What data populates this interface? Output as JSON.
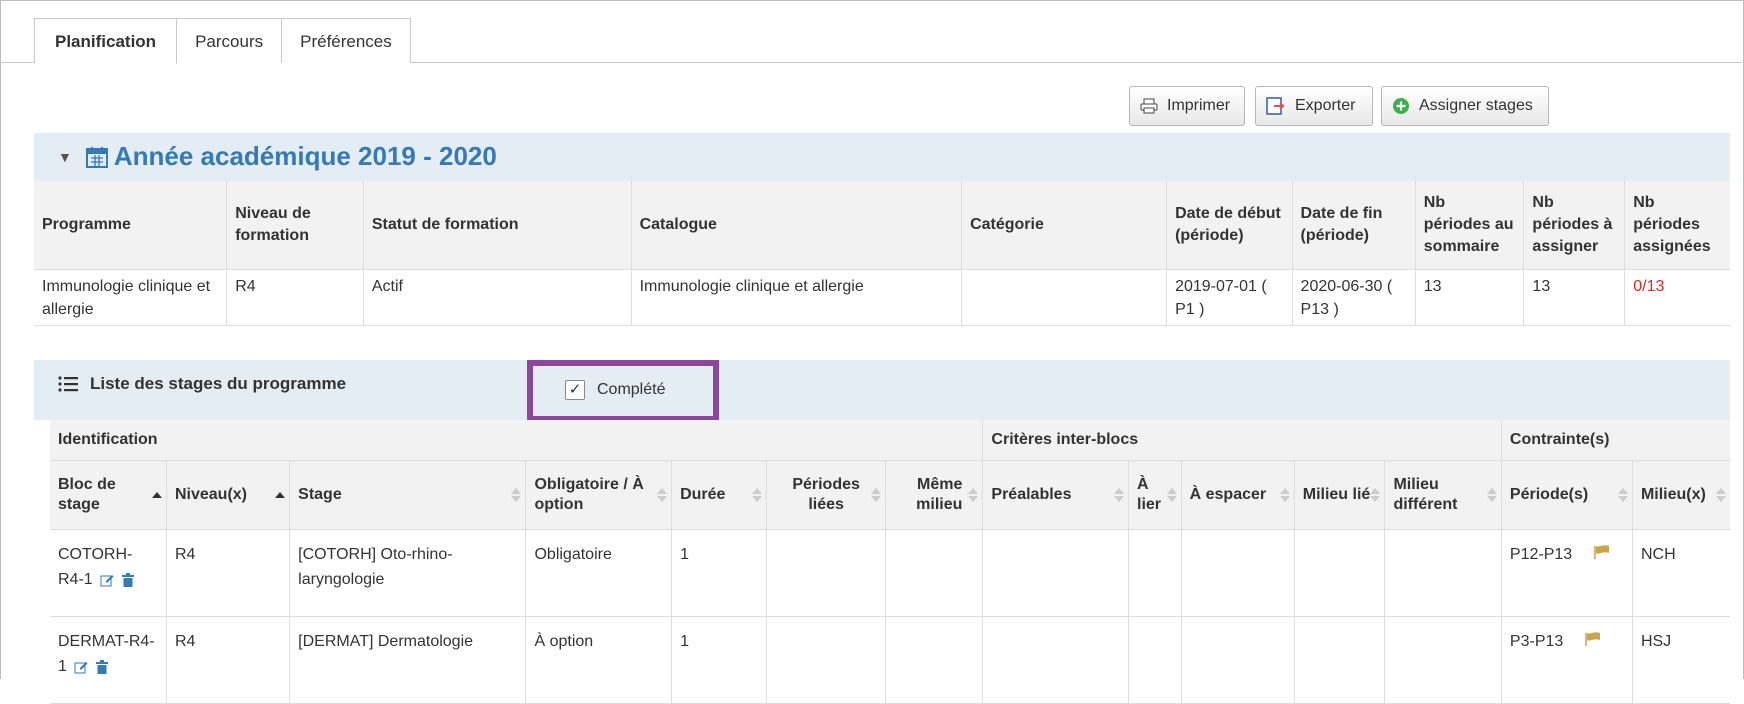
{
  "tabs": [
    "Planification",
    "Parcours",
    "Préférences"
  ],
  "toolbar": {
    "print": "Imprimer",
    "export": "Exporter",
    "assign": "Assigner stages"
  },
  "year": {
    "title": "Année académique 2019 - 2020"
  },
  "program_table": {
    "headers": [
      "Programme",
      "Niveau de formation",
      "Statut de formation",
      "Catalogue",
      "Catégorie",
      "Date de début (période)",
      "Date de fin (période)",
      "Nb périodes au sommaire",
      "Nb périodes à assigner",
      "Nb périodes assignées"
    ],
    "row": [
      "Immunologie clinique et allergie",
      "R4",
      "Actif",
      "Immunologie clinique et allergie",
      "",
      "2019-07-01 ( P1 )",
      "2020-06-30 ( P13 )",
      "13",
      "13",
      "0/13"
    ]
  },
  "stage_list": {
    "title": "Liste des stages du programme",
    "complete_label": "Complété",
    "complete_checked": true
  },
  "stages_table": {
    "groups": [
      "Identification",
      "Critères inter-blocs",
      "Contrainte(s)"
    ],
    "headers": [
      "Bloc de stage",
      "Niveau(x)",
      "Stage",
      "Obligatoire / À option",
      "Durée",
      "Périodes liées",
      "Même milieu",
      "Préalables",
      "À lier",
      "À espacer",
      "Milieu lié",
      "Milieu différent",
      "Période(s)",
      "Milieu(x)"
    ],
    "rows": [
      [
        "COTORH-R4-1",
        "R4",
        "[COTORH] Oto-rhino-laryngologie",
        "Obligatoire",
        "1",
        "",
        "",
        "",
        "",
        "",
        "",
        "",
        "P12-P13",
        "NCH"
      ],
      [
        "DERMAT-R4-1",
        "R4",
        "[DERMAT] Dermatologie",
        "À option",
        "1",
        "",
        "",
        "",
        "",
        "",
        "",
        "",
        "P3-P13",
        "HSJ"
      ]
    ]
  },
  "colors": {
    "accent": "#337ab7",
    "highlight": "#8e44a3",
    "alert": "#e0261f",
    "flag": "#c8a44b"
  }
}
